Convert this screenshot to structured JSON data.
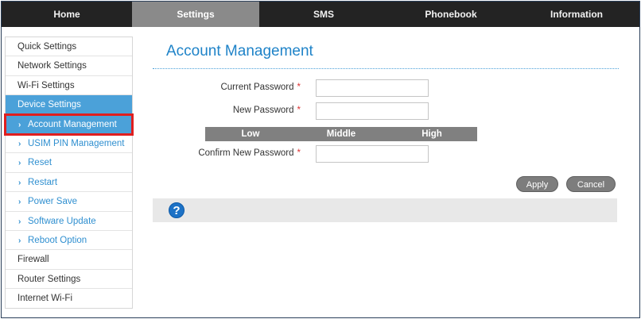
{
  "nav": {
    "tabs": [
      {
        "label": "Home"
      },
      {
        "label": "Settings"
      },
      {
        "label": "SMS"
      },
      {
        "label": "Phonebook"
      },
      {
        "label": "Information"
      }
    ],
    "active": "Settings"
  },
  "sidebar": {
    "items": [
      {
        "label": "Quick Settings"
      },
      {
        "label": "Network Settings"
      },
      {
        "label": "Wi-Fi Settings"
      },
      {
        "label": "Device Settings"
      },
      {
        "label": "Account Management"
      },
      {
        "label": "USIM PIN Management"
      },
      {
        "label": "Reset"
      },
      {
        "label": "Restart"
      },
      {
        "label": "Power Save"
      },
      {
        "label": "Software Update"
      },
      {
        "label": "Reboot Option"
      },
      {
        "label": "Firewall"
      },
      {
        "label": "Router Settings"
      },
      {
        "label": "Internet Wi-Fi"
      }
    ]
  },
  "main": {
    "title": "Account Management",
    "form": {
      "current_password_label": "Current Password",
      "new_password_label": "New Password",
      "confirm_password_label": "Confirm New Password",
      "required_mark": "*",
      "current_password_value": "",
      "new_password_value": "",
      "confirm_password_value": ""
    },
    "strength": {
      "low": "Low",
      "middle": "Middle",
      "high": "High"
    },
    "buttons": {
      "apply": "Apply",
      "cancel": "Cancel"
    },
    "help_icon_glyph": "?"
  },
  "colors": {
    "nav_bg": "#232323",
    "nav_active": "#8a8a8a",
    "accent_blue": "#4ba1d9",
    "title_blue": "#1f83c8",
    "highlight_red": "#e01e1e",
    "button_gray": "#7d7d7d"
  }
}
